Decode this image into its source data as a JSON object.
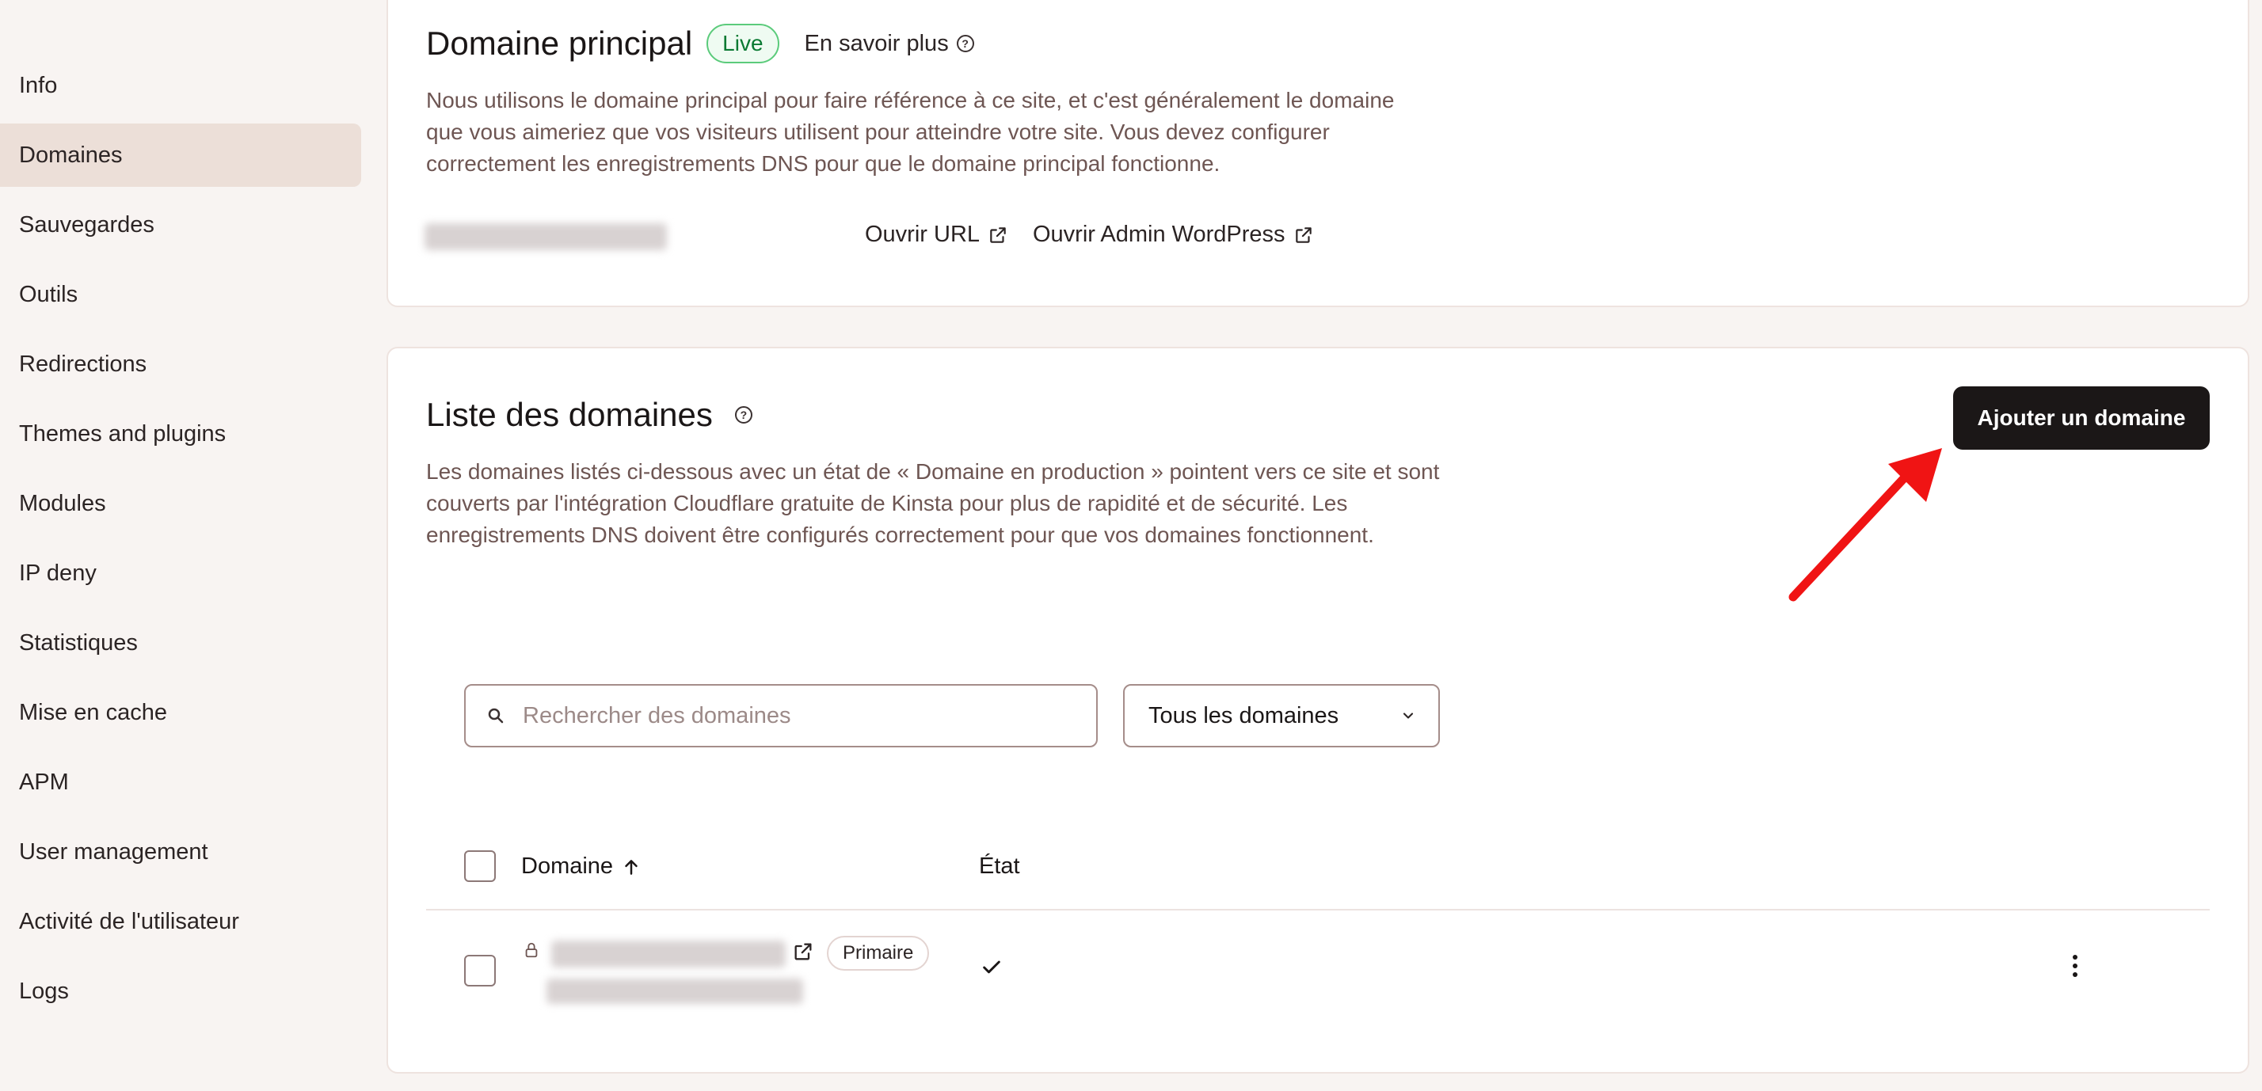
{
  "sidebar": {
    "items": [
      {
        "label": "Info",
        "active": false
      },
      {
        "label": "Domaines",
        "active": true
      },
      {
        "label": "Sauvegardes",
        "active": false
      },
      {
        "label": "Outils",
        "active": false
      },
      {
        "label": "Redirections",
        "active": false
      },
      {
        "label": "Themes and plugins",
        "active": false
      },
      {
        "label": "Modules",
        "active": false
      },
      {
        "label": "IP deny",
        "active": false
      },
      {
        "label": "Statistiques",
        "active": false
      },
      {
        "label": "Mise en cache",
        "active": false
      },
      {
        "label": "APM",
        "active": false
      },
      {
        "label": "User management",
        "active": false
      },
      {
        "label": "Activité de l'utilisateur",
        "active": false
      },
      {
        "label": "Logs",
        "active": false
      }
    ]
  },
  "primary_domain": {
    "title": "Domaine principal",
    "badge": "Live",
    "learn_more": "En savoir plus",
    "description": "Nous utilisons le domaine principal pour faire référence à ce site, et c'est généralement le domaine que vous aimeriez que vos visiteurs utilisent pour atteindre votre site. Vous devez configurer correctement les enregistrements DNS pour que le domaine principal fonctionne.",
    "open_url": "Ouvrir URL",
    "open_admin": "Ouvrir Admin WordPress"
  },
  "domain_list": {
    "title": "Liste des domaines",
    "description": "Les domaines listés ci-dessous avec un état de « Domaine en production » pointent vers ce site et sont couverts par l'intégration Cloudflare gratuite de Kinsta pour plus de rapidité et de sécurité. Les enregistrements DNS doivent être configurés correctement pour que vos domaines fonctionnent.",
    "add_button": "Ajouter un domaine",
    "search_placeholder": "Rechercher des domaines",
    "filter_selected": "Tous les domaines",
    "columns": {
      "domain": "Domaine",
      "status": "État"
    },
    "rows": [
      {
        "tag": "Primaire",
        "status_icon": "check-icon"
      }
    ]
  },
  "colors": {
    "accent_dark": "#1b1717",
    "live_green": "#0b7a33",
    "annotation_red": "#f01414",
    "active_nav_bg": "#ecdfd8"
  }
}
